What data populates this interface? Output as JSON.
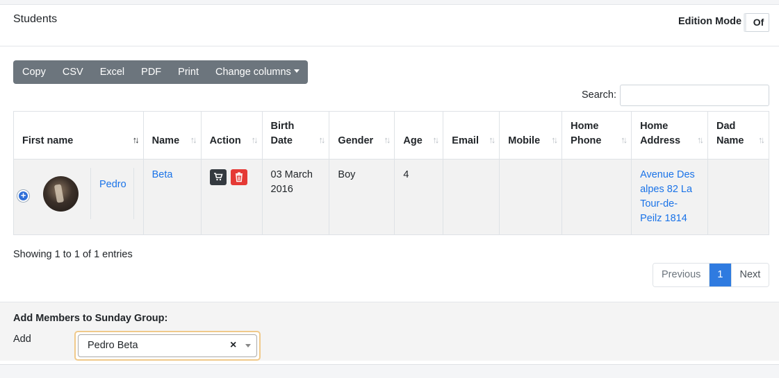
{
  "header": {
    "title": "Students",
    "edition_label": "Edition Mode",
    "toggle_text": "Of"
  },
  "toolbar": {
    "buttons": [
      "Copy",
      "CSV",
      "Excel",
      "PDF",
      "Print",
      "Change columns"
    ]
  },
  "search": {
    "label": "Search:",
    "value": ""
  },
  "table": {
    "columns": [
      {
        "line1": "First name",
        "line2": ""
      },
      {
        "line1": "Name",
        "line2": ""
      },
      {
        "line1": "Action",
        "line2": ""
      },
      {
        "line1": "Birth",
        "line2": "Date"
      },
      {
        "line1": "Gender",
        "line2": ""
      },
      {
        "line1": "Age",
        "line2": ""
      },
      {
        "line1": "Email",
        "line2": ""
      },
      {
        "line1": "Mobile",
        "line2": ""
      },
      {
        "line1": "Home",
        "line2": "Phone"
      },
      {
        "line1": "Home",
        "line2": "Address"
      },
      {
        "line1": "Dad",
        "line2": "Name"
      }
    ],
    "rows": [
      {
        "first_name": "Pedro",
        "name": "Beta",
        "birth_date_1": "03 March",
        "birth_date_2": "2016",
        "gender": "Boy",
        "age": "4",
        "email": "",
        "mobile": "",
        "home_phone": "",
        "address_1": "Avenue Des",
        "address_2": "alpes 82 La",
        "address_3": "Tour-de-",
        "address_4": "Peilz 1814",
        "dad_name": ""
      }
    ]
  },
  "info": {
    "showing": "Showing 1 to 1 of 1 entries"
  },
  "pagination": {
    "previous": "Previous",
    "current": "1",
    "next": "Next"
  },
  "footer": {
    "title": "Add Members to Sunday Group:",
    "add_label": "Add",
    "select_value": "Pedro Beta",
    "clear": "×"
  },
  "colors": {
    "primary": "#2f7be0",
    "link": "#1a73e8",
    "toolbar": "#6c757d",
    "danger": "#e53935",
    "dark": "#343a40"
  },
  "icons": {
    "sort_active": "sort-asc-icon",
    "sort": "sort-icon",
    "expand": "plus-circle-icon",
    "cart": "cart-icon",
    "delete": "trash-icon"
  }
}
